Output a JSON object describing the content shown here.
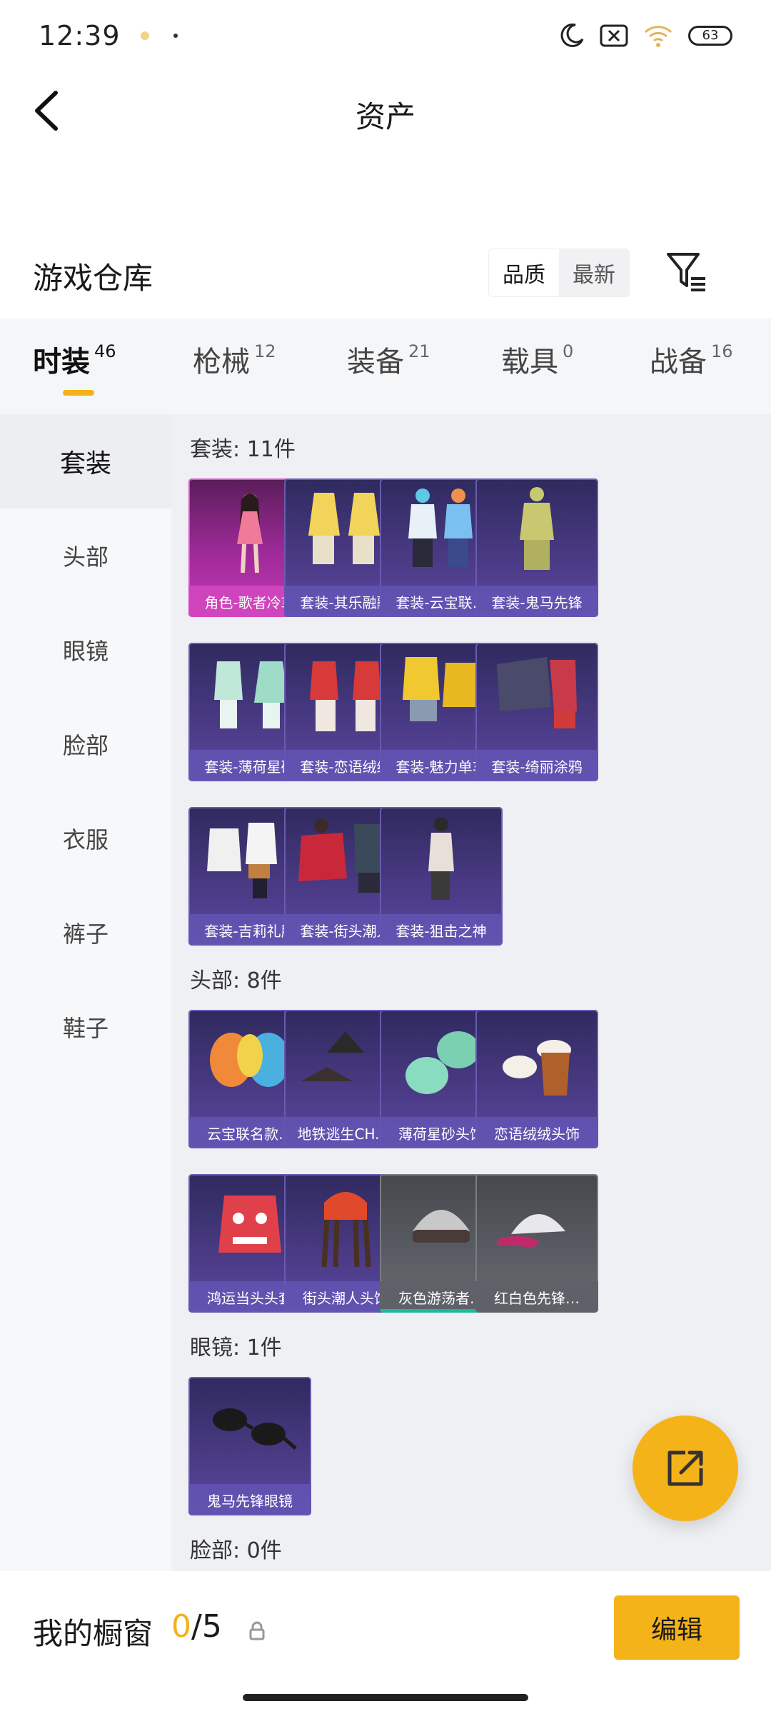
{
  "status": {
    "time": "12:39",
    "battery": "63"
  },
  "header": {
    "title": "资产"
  },
  "section": {
    "title": "游戏仓库",
    "sort_quality": "品质",
    "sort_newest": "最新"
  },
  "tabs": [
    {
      "label": "时装",
      "count": "46"
    },
    {
      "label": "枪械",
      "count": "12"
    },
    {
      "label": "装备",
      "count": "21"
    },
    {
      "label": "载具",
      "count": "0"
    },
    {
      "label": "战备",
      "count": "16"
    }
  ],
  "sidebar": {
    "items": [
      {
        "label": "套装"
      },
      {
        "label": "头部"
      },
      {
        "label": "眼镜"
      },
      {
        "label": "脸部"
      },
      {
        "label": "衣服"
      },
      {
        "label": "裤子"
      },
      {
        "label": "鞋子"
      }
    ]
  },
  "groups": {
    "suits": {
      "label": "套装: 11件",
      "items": [
        "角色-歌者冷鸢",
        "套装-其乐融融",
        "套装-云宝联…",
        "套装-鬼马先锋",
        "套装-薄荷星砂",
        "套装-恋语绒绒",
        "套装-魅力单车",
        "套装-绮丽涂鸦",
        "套装-吉莉礼服",
        "套装-街头潮人",
        "套装-狙击之神"
      ]
    },
    "head": {
      "label": "头部: 8件",
      "items": [
        "云宝联名款…",
        "地铁逃生CH.…",
        "薄荷星砂头饰",
        "恋语绒绒头饰",
        "鸿运当头头套",
        "街头潮人头饰",
        "灰色游荡者…",
        "红白色先锋…"
      ]
    },
    "glasses": {
      "label": "眼镜: 1件",
      "items": [
        "鬼马先锋眼镜"
      ]
    },
    "face": {
      "label": "脸部: 0件"
    }
  },
  "bottom": {
    "title": "我的橱窗",
    "count": "0",
    "separator": "/",
    "max": "5",
    "edit_label": "编辑"
  },
  "colors": {
    "accent": "#f5b31a",
    "card_purple": "#4b3b86",
    "card_pink": "#a02a9a",
    "card_gray": "#5b5d64"
  }
}
